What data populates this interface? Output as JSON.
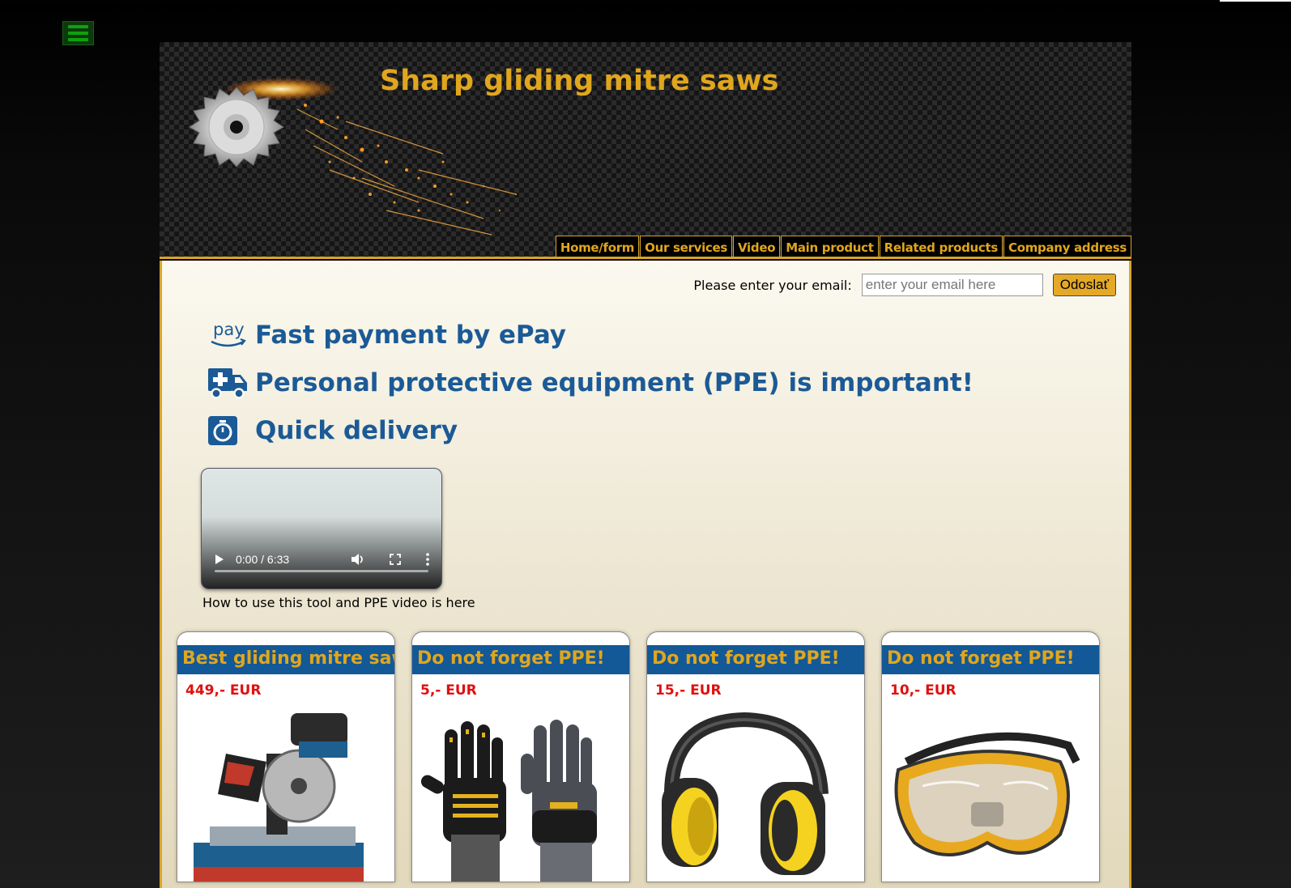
{
  "site": {
    "title": "Sharp gliding mitre saws"
  },
  "nav": {
    "items": [
      {
        "label": "Home/form"
      },
      {
        "label": "Our services"
      },
      {
        "label": "Video"
      },
      {
        "label": "Main product"
      },
      {
        "label": "Related products"
      },
      {
        "label": "Company address"
      }
    ]
  },
  "email_form": {
    "label": "Please enter your email:",
    "placeholder": "enter your email here",
    "value": "",
    "submit_label": "Odoslať"
  },
  "features": [
    {
      "icon": "amazon-pay-icon",
      "icon_text": "pay",
      "text": "Fast payment by ePay"
    },
    {
      "icon": "ambulance-icon",
      "text": "Personal protective equipment (PPE) is important!"
    },
    {
      "icon": "stopwatch-icon",
      "text": "Quick delivery"
    }
  ],
  "video": {
    "time": "0:00 / 6:33",
    "caption": "How to use this tool and PPE video is here"
  },
  "cards": [
    {
      "title": "Best gliding mitre saw",
      "price": "449,- EUR",
      "image": "mitre-saw"
    },
    {
      "title": "Do not forget PPE!",
      "price": "5,- EUR",
      "image": "gloves"
    },
    {
      "title": "Do not forget PPE!",
      "price": "15,- EUR",
      "image": "ear-muffs"
    },
    {
      "title": "Do not forget PPE!",
      "price": "10,- EUR",
      "image": "safety-goggles"
    }
  ],
  "colors": {
    "accent_gold": "#e0a61e",
    "feature_blue": "#1b5a96",
    "card_header_blue": "#135897",
    "price_red": "#e10f0f"
  }
}
